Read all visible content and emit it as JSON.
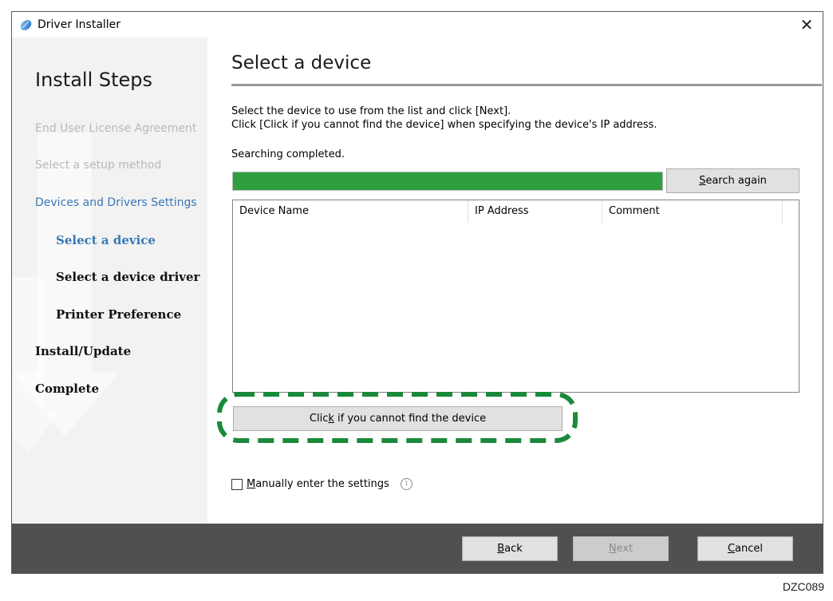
{
  "window": {
    "title": "Driver Installer",
    "close_glyph": "✕"
  },
  "sidebar": {
    "title": "Install Steps",
    "steps": [
      {
        "label": "End User License Agreement",
        "state": "done"
      },
      {
        "label": "Select a setup method",
        "state": "done"
      },
      {
        "label": "Devices and Drivers Settings",
        "state": "current"
      },
      {
        "label": "Select a device",
        "state": "current-sub"
      },
      {
        "label": "Select a device driver",
        "state": "pending"
      },
      {
        "label": "Printer Preference",
        "state": "pending"
      },
      {
        "label": "Install/Update",
        "state": "pending"
      },
      {
        "label": "Complete",
        "state": "pending"
      }
    ]
  },
  "main": {
    "title": "Select a device",
    "instruction_line1": "Select the device to use from the list and click [Next].",
    "instruction_line2": "Click [Click if you cannot find the device] when specifying the device's IP address.",
    "status": "Searching completed.",
    "progress_fraction": 1.0,
    "search_again": {
      "pre": "",
      "key": "S",
      "post": "earch again"
    },
    "table": {
      "columns": [
        "Device Name",
        "IP Address",
        "Comment"
      ],
      "rows": []
    },
    "cannot_find": {
      "pre": "Clic",
      "key": "k",
      "post": " if you cannot find the device"
    },
    "manual": {
      "pre": "",
      "key": "M",
      "post": "anually enter the settings",
      "checked": false
    },
    "info_glyph": "i"
  },
  "footer": {
    "back": {
      "key": "B",
      "post": "ack"
    },
    "next": {
      "key": "N",
      "post": "ext",
      "enabled": false
    },
    "cancel": {
      "key": "C",
      "post": "ancel"
    }
  },
  "figure_code": "DZC089",
  "colors": {
    "progress": "#2e9e3e",
    "highlight_dash": "#1a8a3a",
    "footer": "#505050",
    "current_step": "#3a78b4"
  }
}
